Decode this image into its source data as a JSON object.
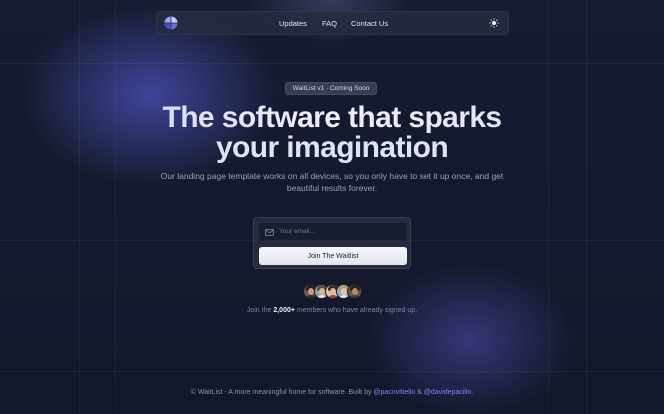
{
  "nav": {
    "links": [
      "Updates",
      "FAQ",
      "Contact Us"
    ],
    "logo_icon": "pie-logo-icon",
    "theme_icon": "sun-icon"
  },
  "badge": {
    "label": "WaitList v1 · Coming Soon"
  },
  "hero": {
    "title_line1": "The software that sparks",
    "title_line2": "your imagination",
    "subtitle_line1": "Our landing page template works on all devices, so you only have to set it up once, and get",
    "subtitle_line2": "beautiful results forever."
  },
  "form": {
    "email_placeholder": "Your email...",
    "submit_label": "Join The Waitlist",
    "email_icon": "mail-icon"
  },
  "social_proof": {
    "prefix": "Join the",
    "count": "2,000+",
    "suffix": "members who have already signed up."
  },
  "footer": {
    "text": "© WaitList - A more meaningful home for software. Built by",
    "author1": "@pacovitiello",
    "and": "&",
    "author2": "@davidepacilio",
    "end": "."
  },
  "colors": {
    "background": "#141a2e",
    "accent": "#7c83ff",
    "glow": "#6366f1"
  }
}
